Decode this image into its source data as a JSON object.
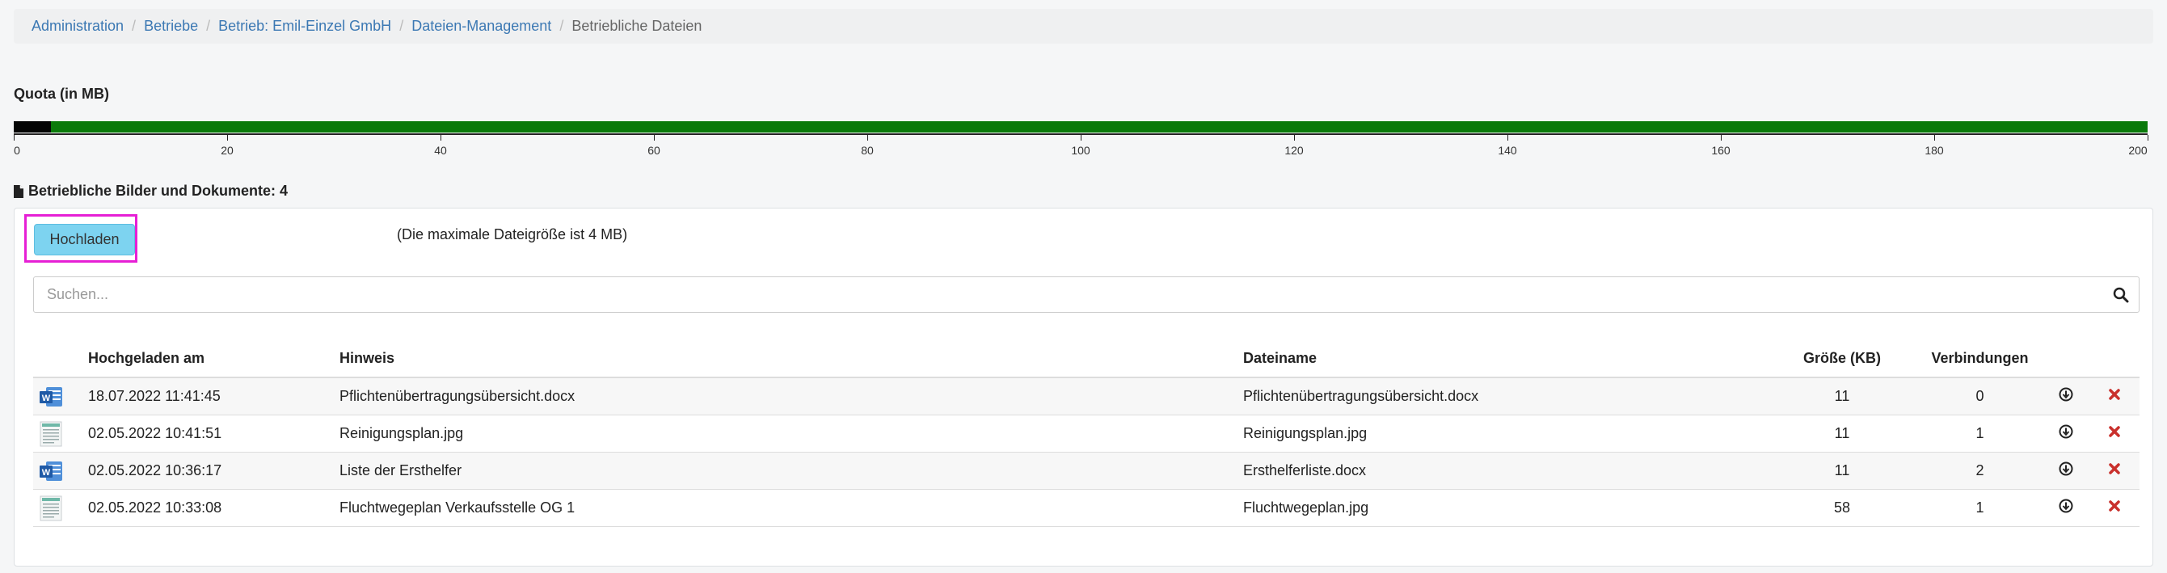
{
  "breadcrumb": [
    {
      "label": "Administration"
    },
    {
      "label": "Betriebe"
    },
    {
      "label": "Betrieb: Emil-Einzel GmbH"
    },
    {
      "label": "Dateien-Management"
    },
    {
      "label": "Betriebliche Dateien",
      "current": true
    }
  ],
  "quota": {
    "title": "Quota (in MB)",
    "used_mb": 3.5,
    "max_mb": 200,
    "ticks": [
      "0",
      "20",
      "40",
      "60",
      "80",
      "100",
      "120",
      "140",
      "160",
      "180",
      "200"
    ],
    "colors": {
      "used": "#050505",
      "free": "#0a7a0a"
    }
  },
  "section": {
    "title": "Betriebliche Bilder und Dokumente: 4",
    "icon": "file-icon"
  },
  "upload": {
    "label": "Hochladen",
    "note": "(Die maximale Dateigröße ist 4 MB)"
  },
  "search": {
    "placeholder": "Suchen...",
    "value": "",
    "icon": "search-icon"
  },
  "table": {
    "headers": {
      "uploaded": "Hochgeladen am",
      "hint": "Hinweis",
      "filename": "Dateiname",
      "size": "Größe (KB)",
      "connections": "Verbindungen"
    },
    "rows": [
      {
        "icon": "word-doc-icon",
        "uploaded": "18.07.2022 11:41:45",
        "hint": "Pflichtenübertragungsübersicht.docx",
        "filename": "Pflichtenübertragungsübersicht.docx",
        "size": "11",
        "connections": "0"
      },
      {
        "icon": "image-thumbnail-icon",
        "uploaded": "02.05.2022 10:41:51",
        "hint": "Reinigungsplan.jpg",
        "filename": "Reinigungsplan.jpg",
        "size": "11",
        "connections": "1"
      },
      {
        "icon": "word-doc-icon",
        "uploaded": "02.05.2022 10:36:17",
        "hint": "Liste der Ersthelfer",
        "filename": "Ersthelferliste.docx",
        "size": "11",
        "connections": "2"
      },
      {
        "icon": "image-thumbnail-icon",
        "uploaded": "02.05.2022 10:33:08",
        "hint": "Fluchtwegeplan Verkaufsstelle OG 1",
        "filename": "Fluchtwegeplan.jpg",
        "size": "58",
        "connections": "1"
      }
    ]
  },
  "colors": {
    "link": "#3b78b3",
    "delete": "#c9302c",
    "upload_button": "#7dd3f0",
    "highlight": "#e61fd5"
  }
}
